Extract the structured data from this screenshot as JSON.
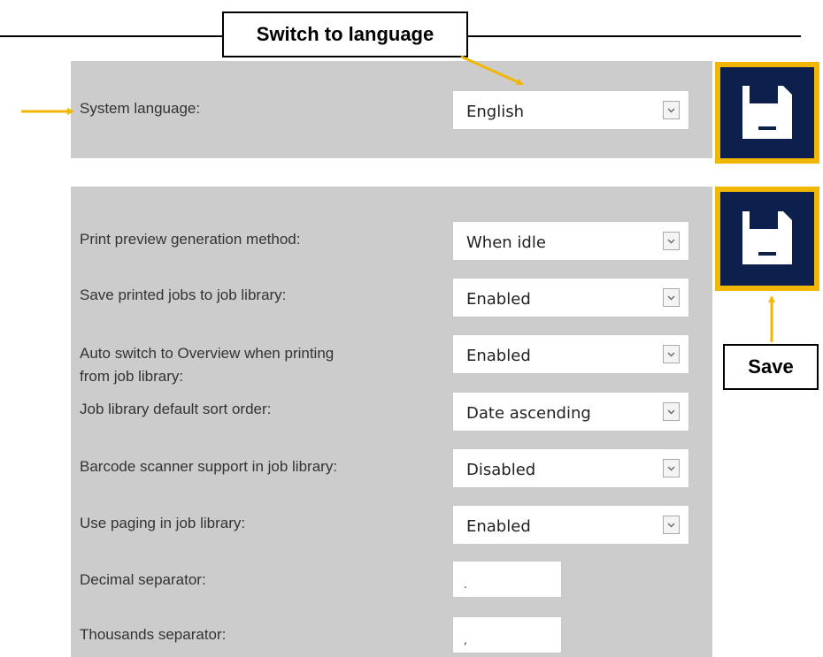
{
  "annotations": {
    "switch_language_label": "Switch to language",
    "save_label": "Save",
    "highlight_color": "#f2b705"
  },
  "language_section": {
    "label": "System language:",
    "value": "English"
  },
  "settings": {
    "print_preview": {
      "label": "Print preview generation method:",
      "value": "When idle"
    },
    "save_printed_jobs": {
      "label": "Save printed jobs to job library:",
      "value": "Enabled"
    },
    "auto_switch": {
      "label_line1": "Auto switch to Overview when printing",
      "label_line2": "from job library:",
      "value": "Enabled"
    },
    "sort_order": {
      "label": "Job library default sort order:",
      "value": "Date ascending"
    },
    "barcode": {
      "label": "Barcode scanner support in job library:",
      "value": "Disabled"
    },
    "paging": {
      "label": "Use paging in job library:",
      "value": "Enabled"
    },
    "decimal_separator": {
      "label": "Decimal separator:",
      "value": "."
    },
    "thousands_separator": {
      "label": "Thousands separator:",
      "value": ","
    }
  },
  "icons": {
    "save": "floppy-disk-icon",
    "dropdown": "chevron-down-icon"
  },
  "colors": {
    "panel_bg": "#cccccc",
    "save_button_bg": "#0c1f4d",
    "highlight": "#f2b705"
  }
}
